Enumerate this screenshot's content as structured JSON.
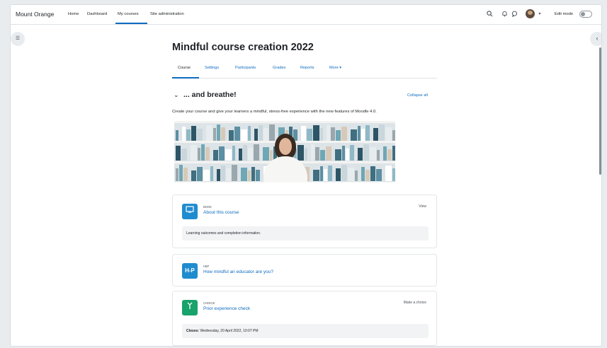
{
  "navbar": {
    "brand": "Mount Orange",
    "links": [
      "Home",
      "Dashboard",
      "My courses",
      "Site administration"
    ],
    "edit_mode_label": "Edit mode"
  },
  "course": {
    "title": "Mindful course creation 2022",
    "tabs": [
      "Course",
      "Settings",
      "Participants",
      "Grades",
      "Reports",
      "More ▾"
    ]
  },
  "section": {
    "title": "... and breathe!",
    "collapse_all": "Collapse all",
    "summary": "Create your course and give your learners a mindful, stress-free experience with the new features of Moodle 4.0."
  },
  "activities": [
    {
      "type": "Book",
      "name": "About this course",
      "action": "View",
      "icon_text": "",
      "icon_color": "#1f8ccf",
      "info": "Learning outcomes and completion information."
    },
    {
      "type": "H5P",
      "name": "How mindful an educator are you?",
      "action": "",
      "icon_text": "H-P",
      "icon_color": "#1f8ccf",
      "info": ""
    },
    {
      "type": "Choice",
      "name": "Prior experience check",
      "action": "Make a choice",
      "icon_text": "",
      "icon_color": "#17a36a",
      "info_label": "Closes:",
      "info_value": "Wednesday, 20 April 2022, 10:07 PM"
    }
  ],
  "colors": {
    "primary_link": "#0f6cbf",
    "book_icon": "#1f8ccf",
    "choice_icon": "#17a36a"
  }
}
